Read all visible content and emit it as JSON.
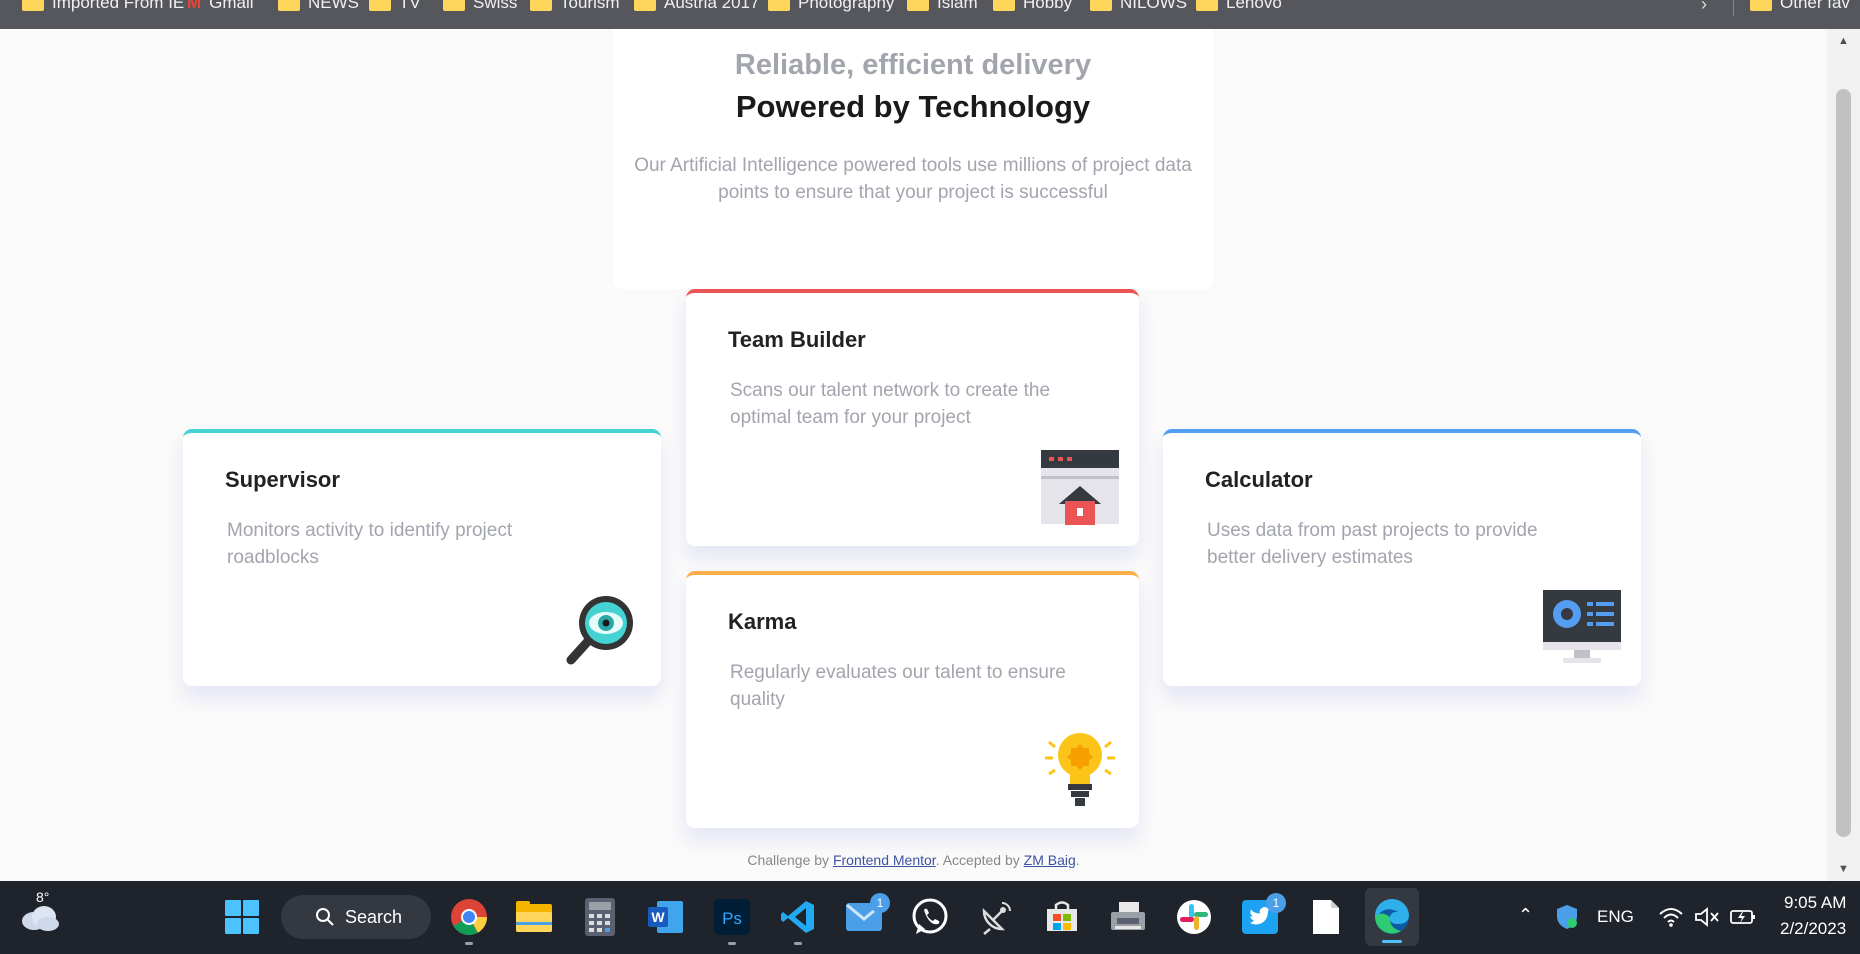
{
  "browser": {
    "bookmarks": [
      {
        "label": "Imported From IE",
        "icon": "folder-icon"
      },
      {
        "label": "Gmail",
        "icon": "gmail-icon"
      },
      {
        "label": "NEWS",
        "icon": "folder-icon"
      },
      {
        "label": "TV",
        "icon": "folder-icon"
      },
      {
        "label": "Swiss",
        "icon": "folder-icon"
      },
      {
        "label": "Tourism",
        "icon": "folder-icon"
      },
      {
        "label": "Austria 2017",
        "icon": "folder-icon"
      },
      {
        "label": "Photography",
        "icon": "folder-icon"
      },
      {
        "label": "Islam",
        "icon": "folder-icon"
      },
      {
        "label": "Hobby",
        "icon": "folder-icon"
      },
      {
        "label": "NILOWS",
        "icon": "folder-icon"
      },
      {
        "label": "Lenovo",
        "icon": "folder-icon"
      }
    ],
    "other_bookmarks": "Other fav",
    "more_icon": "chevron-right-icon"
  },
  "page": {
    "hero": {
      "subtitle": "Reliable, efficient delivery",
      "title": "Powered by Technology",
      "description": "Our Artificial Intelligence powered tools use millions of project data points to ensure that your project is successful"
    },
    "cards": {
      "supervisor": {
        "title": "Supervisor",
        "description": "Monitors activity to identify project roadblocks",
        "accent": "#44d3d2",
        "icon": "magnifier-eye-icon"
      },
      "team_builder": {
        "title": "Team Builder",
        "description": "Scans our talent network to create the optimal team for your project",
        "accent": "#ea5454",
        "icon": "team-builder-icon"
      },
      "karma": {
        "title": "Karma",
        "description": "Regularly evaluates our talent to ensure quality",
        "accent": "#fcaf4a",
        "icon": "lightbulb-icon"
      },
      "calculator": {
        "title": "Calculator",
        "description": "Uses data from past projects to provide better delivery estimates",
        "accent": "#549ef2",
        "icon": "monitor-chart-icon"
      }
    },
    "attribution": {
      "prefix": "Challenge by",
      "link1": "Frontend Mentor",
      "middle": ". Accepted by",
      "link2": "ZM Baig",
      "suffix": "."
    }
  },
  "taskbar": {
    "weather_temp": "8°",
    "search_label": "Search",
    "apps": [
      "chrome-icon",
      "file-explorer-icon",
      "calculator-icon",
      "word-icon",
      "photoshop-icon",
      "vscode-icon",
      "mail-icon",
      "whatsapp-icon",
      "satellite-icon",
      "store-icon",
      "fax-icon",
      "slack-icon",
      "twitter-icon",
      "file-icon",
      "edge-icon"
    ],
    "mail_badge": "1",
    "twitter_badge": "1",
    "language": "ENG",
    "time": "9:05 AM",
    "date": "2/2/2023"
  }
}
